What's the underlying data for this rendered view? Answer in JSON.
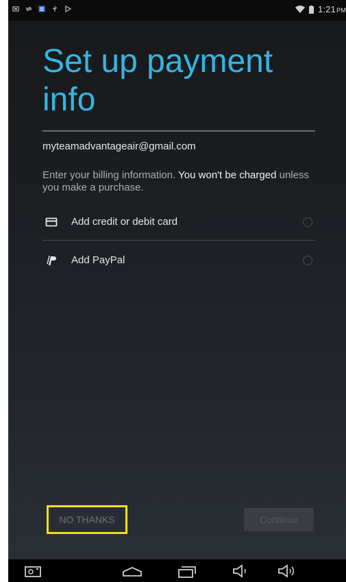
{
  "status_bar": {
    "time": "1:21",
    "ampm": "PM",
    "left_icons": [
      "screenshot-icon",
      "sync-icon",
      "app-notification-icon",
      "usb-icon",
      "play-store-icon"
    ],
    "right_icons": [
      "wifi-icon",
      "battery-icon"
    ]
  },
  "page": {
    "title": "Set up payment info",
    "email": "myteamadvantageair@gmail.com",
    "billing_prefix": "Enter your billing information.",
    "billing_strong": "You won't be charged",
    "billing_suffix": "unless you make a purchase."
  },
  "options": [
    {
      "label": "Add credit or debit card",
      "icon": "credit-card-icon"
    },
    {
      "label": "Add PayPal",
      "icon": "paypal-icon"
    }
  ],
  "actions": {
    "no_thanks": "NO THANKS",
    "continue": "Continue"
  },
  "nav_bar": {
    "icons": [
      "camera-icon",
      "home-icon",
      "recent-apps-icon",
      "volume-down-icon",
      "volume-up-icon"
    ]
  },
  "colors": {
    "accent": "#33b5e5",
    "highlight": "#f0e21a"
  }
}
